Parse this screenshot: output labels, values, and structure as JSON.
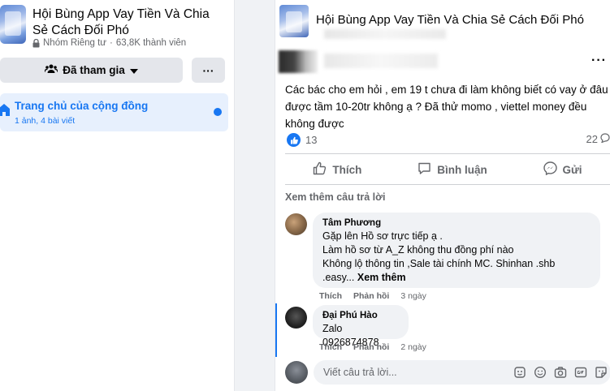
{
  "sidebar": {
    "group_title": "Hội Bùng App Vay Tiền Và Chia Sẻ Cách Đối Phó",
    "privacy": "Nhóm Riêng tư",
    "separator": "·",
    "members": "63,8K thành viên",
    "joined_label": "Đã tham gia",
    "more_label": "···",
    "community": {
      "label": "Trang chủ của cộng đồng",
      "sub": "1 ảnh, 4 bài viết"
    }
  },
  "post": {
    "group_name": "Hội Bùng App Vay Tiền Và Chia Sẻ Cách Đối Phó",
    "menu_label": "···",
    "text": "Các bác cho em hỏi , em 19 t chưa đi làm không biết có vay ở đâu được tầm 10-20tr không ạ ? Đã thử momo , viettel money đều không được",
    "like_count": "13",
    "comment_count": "22",
    "actions": {
      "like": "Thích",
      "comment": "Bình luận",
      "share": "Gửi"
    },
    "see_more_replies": "Xem thêm câu trả lời",
    "comments": [
      {
        "name": "Tâm Phương",
        "text": "Gặp lên Hồ sơ trực tiếp ạ .\nLàm hồ sơ từ A_Z không thu đồng phí nào\nKhông lộ thông tin ,Sale tài chính MC. Shinhan .shb\n.easy...",
        "see_more": "Xem thêm",
        "like": "Thích",
        "reply": "Phản hồi",
        "time": "3 ngày"
      },
      {
        "name": "Đại Phú Hào",
        "text": "Zalo 0926874878",
        "like": "Thích",
        "reply": "Phản hồi",
        "time": "2 ngày"
      }
    ],
    "reply_placeholder": "Viết câu trả lời...",
    "colors": {
      "accent": "#1877f2",
      "secondary_text": "#65676b",
      "bubble": "#f0f2f5"
    }
  }
}
